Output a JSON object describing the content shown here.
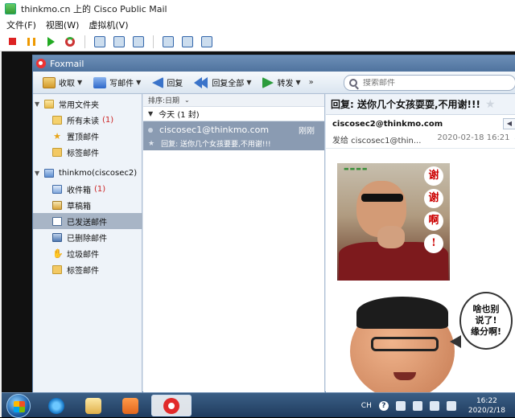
{
  "host": {
    "title": "thinkmo.cn 上的 Cisco Public Mail",
    "menu": [
      "文件(F)",
      "视图(W)",
      "虚拟机(V)"
    ]
  },
  "foxmail": {
    "title": "Foxmail",
    "toolbar": {
      "receive": "收取",
      "write": "写邮件",
      "reply": "回复",
      "reply_all": "回复全部",
      "forward": "转发",
      "more": "»",
      "search_placeholder": "搜索邮件"
    },
    "folders": {
      "common_group": "常用文件夹",
      "all_unread": "所有未读",
      "all_unread_count": "(1)",
      "starred": "置顶邮件",
      "tagged": "标签邮件",
      "account": "thinkmo(ciscosec2)",
      "inbox": "收件箱",
      "inbox_count": "(1)",
      "drafts": "草稿箱",
      "sent": "已发送邮件",
      "deleted": "已删除邮件",
      "junk": "垃圾邮件",
      "account_tagged": "标签邮件"
    },
    "message_list": {
      "sort_label": "排序:日期",
      "group_label": "今天 (1 封)",
      "messages": [
        {
          "from": "ciscosec1@thinkmo.com",
          "time": "刚刚",
          "subject": "回复: 送你几个女孩要要,不用谢!!!"
        }
      ]
    },
    "reader": {
      "subject": "回复: 送你几个女孩耍耍,不用谢!!!",
      "from": "ciscosec2@thinkmo.com",
      "to": "发给 ciscosec1@thin...",
      "date": "2020-02-18 16:21",
      "detail": "详细",
      "image1_text": [
        "谢",
        "谢",
        "啊",
        "!"
      ],
      "image2_text": [
        "啥也别",
        "说了!",
        "缘分啊!"
      ]
    }
  },
  "taskbar": {
    "lang": "CH",
    "help": "?",
    "time": "16:22",
    "date": "2020/2/18"
  }
}
